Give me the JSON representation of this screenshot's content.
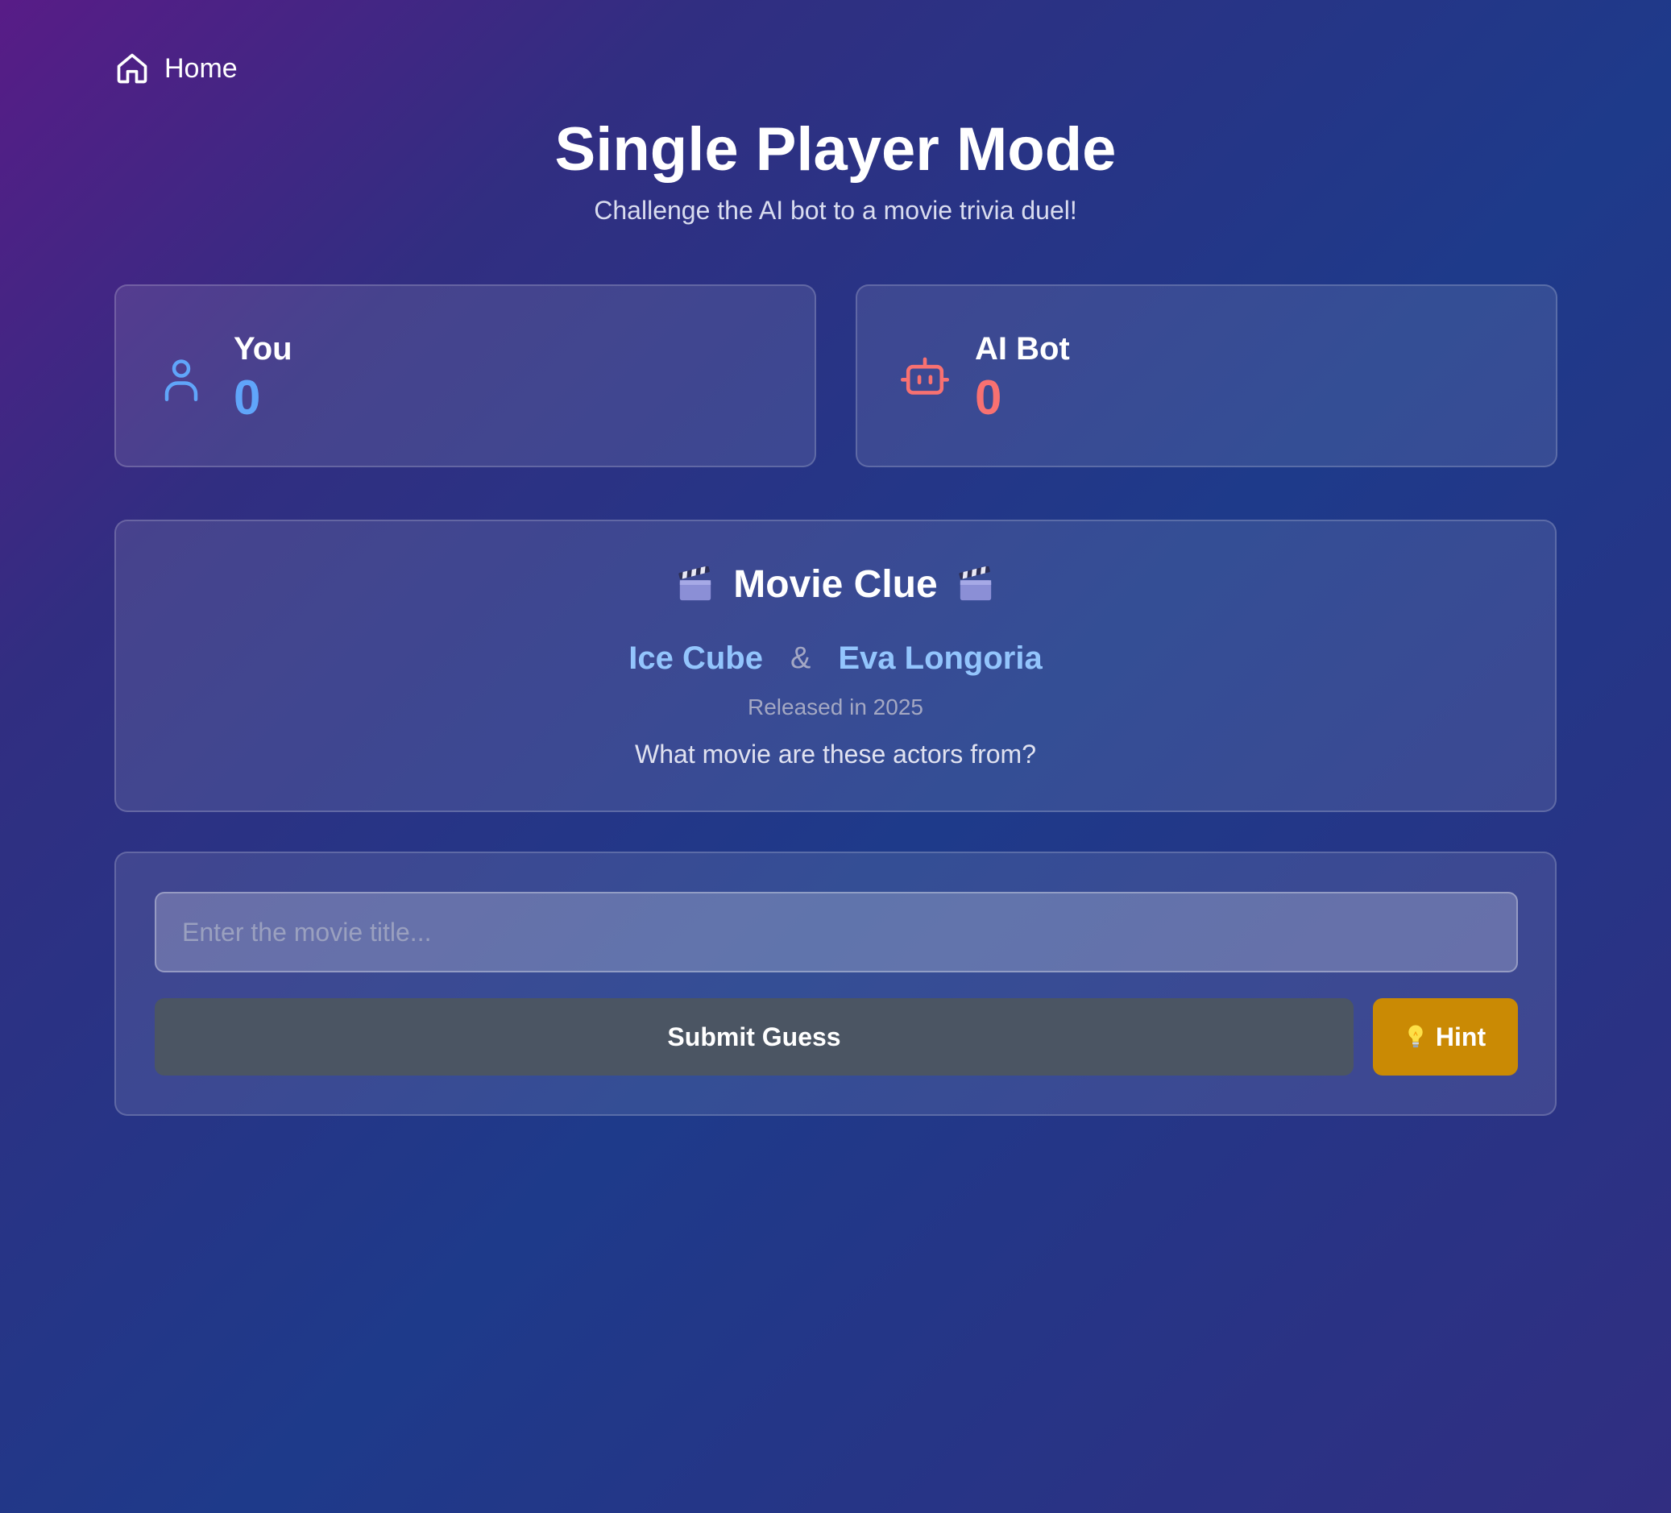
{
  "nav": {
    "home_label": "Home",
    "home_icon": "home-icon"
  },
  "header": {
    "title": "Single Player Mode",
    "subtitle": "Challenge the AI bot to a movie trivia duel!"
  },
  "scores": {
    "player": {
      "name": "You",
      "value": "0",
      "icon": "user-icon",
      "color": "#60a5fa"
    },
    "bot": {
      "name": "AI Bot",
      "value": "0",
      "icon": "robot-icon",
      "color": "#f87171"
    }
  },
  "clue": {
    "title": "Movie Clue",
    "icon": "clapperboard-icon",
    "actor_1": "Ice Cube",
    "separator": "&",
    "actor_2": "Eva Longoria",
    "released": "Released in 2025",
    "question": "What movie are these actors from?"
  },
  "form": {
    "input_placeholder": "Enter the movie title...",
    "input_value": "",
    "submit_label": "Submit Guess",
    "hint_label": "Hint",
    "hint_icon": "lightbulb-icon",
    "submit_color": "#4b5563",
    "hint_color": "#ca8a04"
  }
}
